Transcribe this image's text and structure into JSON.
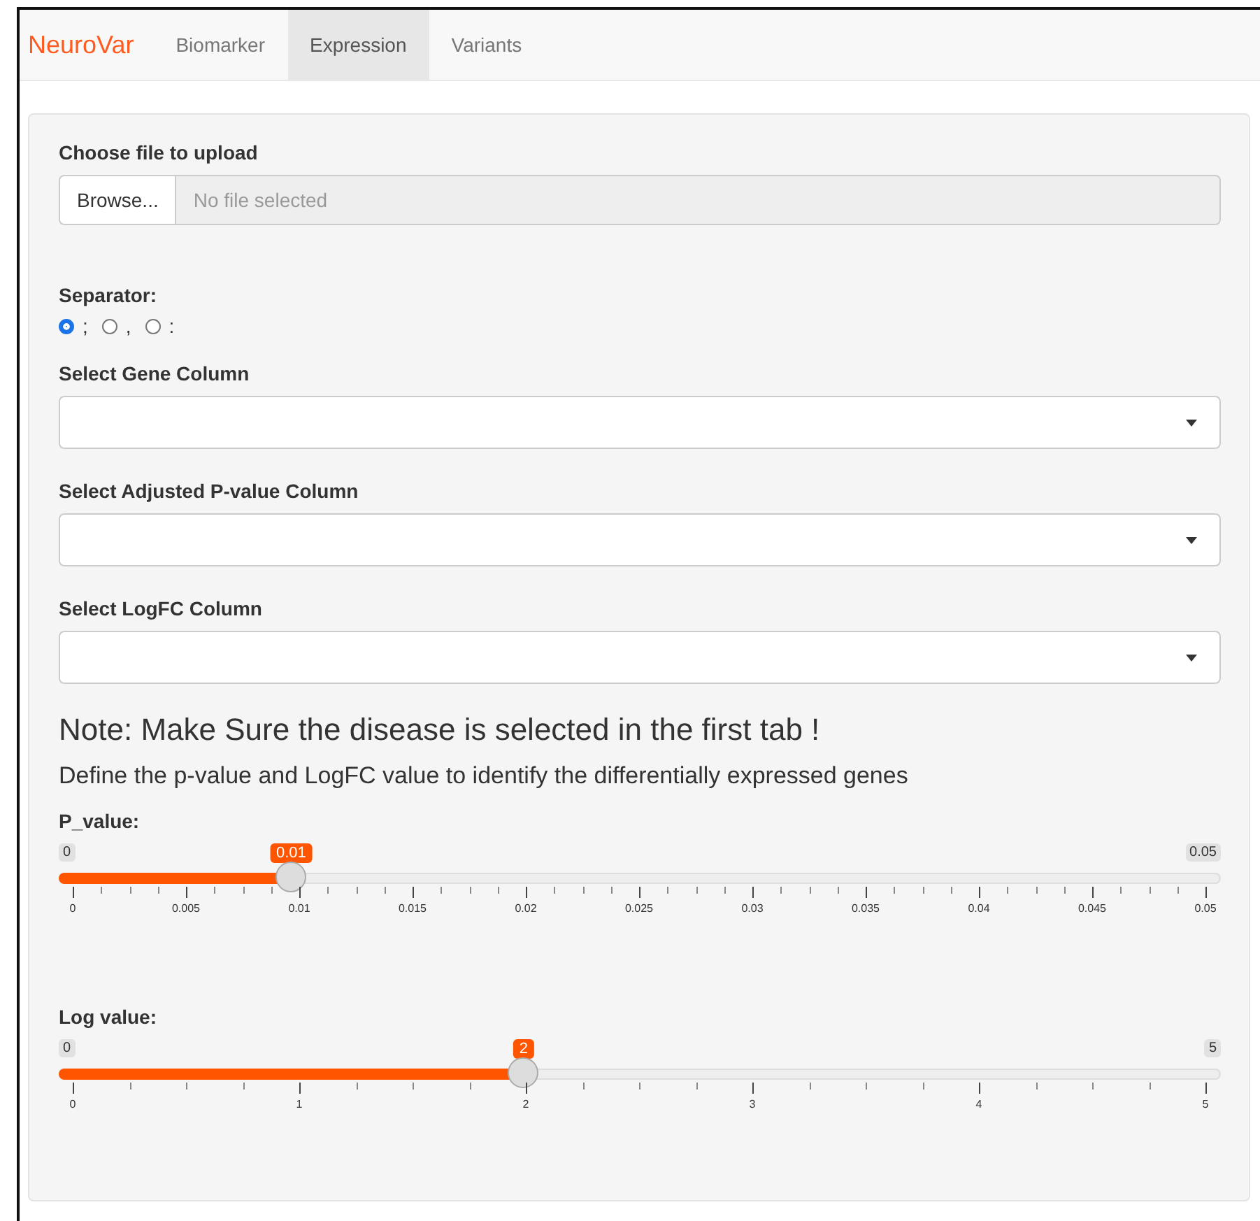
{
  "navbar": {
    "brand": "NeuroVar",
    "tabs": [
      {
        "label": "Biomarker",
        "selected": false
      },
      {
        "label": "Expression",
        "selected": true
      },
      {
        "label": "Variants",
        "selected": false
      }
    ]
  },
  "upload": {
    "label": "Choose file to upload",
    "button": "Browse...",
    "placeholder": "No file selected"
  },
  "separator": {
    "label": "Separator:",
    "options": [
      {
        "label": ";",
        "selected": true
      },
      {
        "label": ",",
        "selected": false
      },
      {
        "label": ":",
        "selected": false
      }
    ]
  },
  "selects": [
    {
      "label": "Select Gene Column"
    },
    {
      "label": "Select Adjusted P-value Column"
    },
    {
      "label": "Select LogFC Column"
    }
  ],
  "note": "Note: Make Sure the disease is selected in the first tab !",
  "description": "Define the p-value and LogFC value to identify the differentially expressed genes",
  "sliders": [
    {
      "label": "P_value:",
      "min": "0",
      "max": "0.05",
      "value": "0.01",
      "level": 0.2,
      "ticks": [
        "0",
        "0.005",
        "0.01",
        "0.015",
        "0.02",
        "0.025",
        "0.03",
        "0.035",
        "0.04",
        "0.045",
        "0.05"
      ]
    },
    {
      "label": "Log value:",
      "min": "0",
      "max": "5",
      "value": "2",
      "level": 0.4,
      "ticks": [
        "0",
        "1",
        "2",
        "3",
        "4",
        "5"
      ]
    }
  ]
}
